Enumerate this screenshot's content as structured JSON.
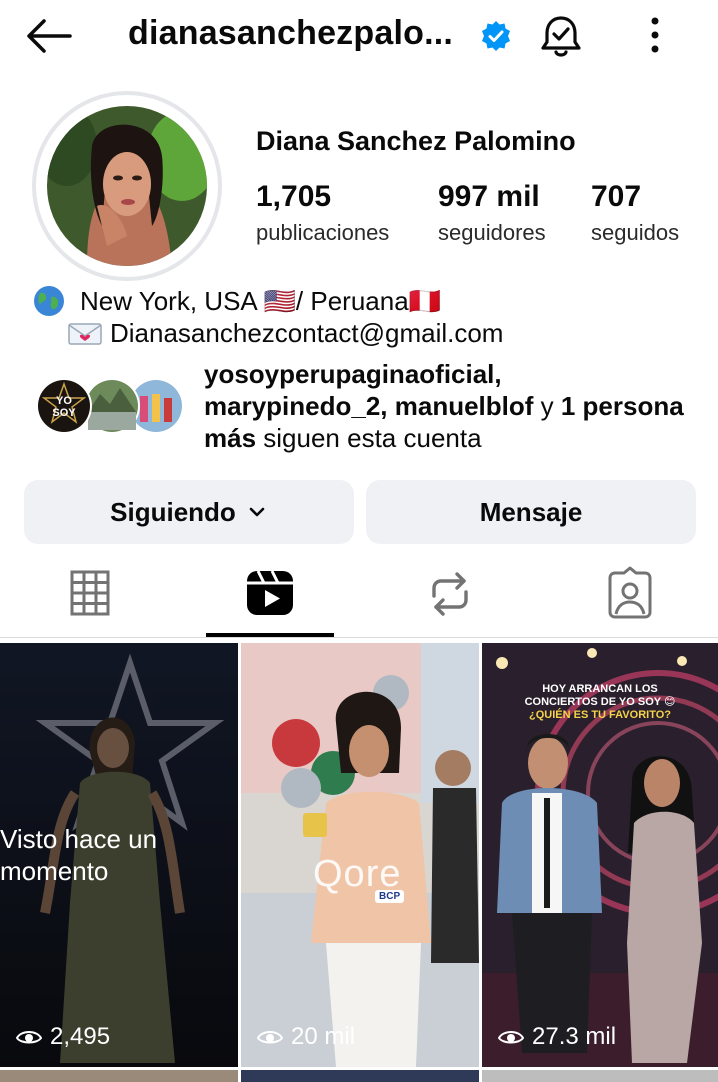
{
  "header": {
    "username": "dianasanchezpalo...",
    "verified": true
  },
  "profile": {
    "full_name": "Diana Sanchez Palomino",
    "stats": [
      {
        "value": "1,705",
        "label": "publicaciones"
      },
      {
        "value": "997 mil",
        "label": "seguidores"
      },
      {
        "value": "707",
        "label": "seguidos"
      }
    ],
    "bio": {
      "location": "New York, USA 🇺🇸/ Peruana🇵🇪",
      "email": "Dianasanchezcontact@gmail.com"
    },
    "followed_by": {
      "names": "yosoyperupaginaoficial, marypinedo_2, manuelblof",
      "connector": " y ",
      "extra": "1 persona más",
      "suffix": " siguen esta cuenta"
    }
  },
  "buttons": {
    "following": "Siguiendo",
    "message": "Mensaje"
  },
  "tabs": {
    "items": [
      "grid-icon",
      "reels-icon",
      "reposts-icon",
      "tagged-icon"
    ],
    "active": "reels-icon"
  },
  "reels": [
    {
      "overlay": "Visto hace un momento",
      "views": "2,495"
    },
    {
      "views": "20 mil",
      "brand": "Qore",
      "brand_tag": "BCP"
    },
    {
      "caption_line1": "HOY ARRANCAN LOS",
      "caption_line2": "CONCIERTOS DE YO SOY 😊",
      "caption_line3": "¿QUIÉN ES TU FAVORITO?",
      "views": "27.3 mil"
    }
  ],
  "colors": {
    "verified_blue": "#0095f6",
    "button_bg": "#eff1f5",
    "tab_active": "#000000",
    "tab_inactive": "#737373"
  }
}
